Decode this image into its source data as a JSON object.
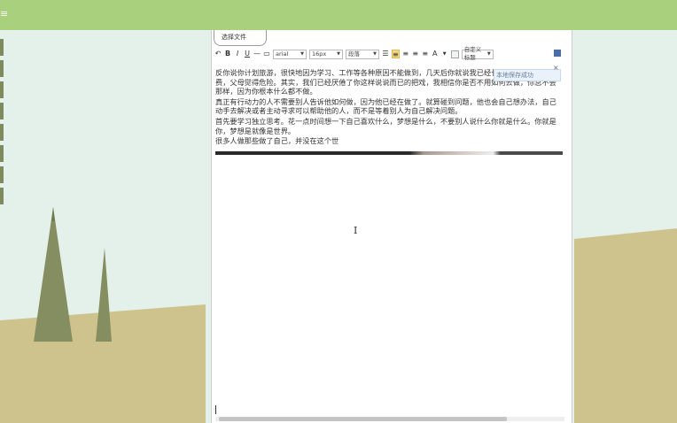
{
  "app": {
    "title": "≡"
  },
  "nav": {
    "items": [
      "",
      "",
      "",
      "",
      "",
      "",
      "",
      ""
    ]
  },
  "editor": {
    "file_button": "选择文件",
    "toolbar": {
      "font_family": "arial",
      "font_size": "16px",
      "format": "段落",
      "text_color": "A",
      "custom_label": "自定义标题"
    },
    "tooltip": "本地保存成功",
    "close_icon": "×",
    "paragraphs": [
      "反你说你计划旅游，很快地因为学习、工作等各种原因不能做到，几天后你就说我已经长途旅行，很是浪费，父母觉得危险。其实，我们已经厌倦了你这样说说而已的把戏，我相信你是否不用如何去做，你总不会那样，因为你根本什么都不做。",
      "真正有行动力的人不需要别人告诉他如何做，因为他已经在做了。就算碰到问题，他也会自己想办法，自己动手去解决或者主动寻求可以帮助他的人，而不是等着别人为自己解决问题。",
      "首先要学习独立思考。花一点时间想一下自己喜欢什么，梦想是什么，不要别人说什么你就是什么。你就是你，梦想是就像是世界。",
      "很多人做那些做了自己，并没在这个世"
    ]
  },
  "colors": {
    "topbar": "#a9d07d",
    "background": "#e4f1ea",
    "hill": "#cfc38d",
    "tree": "#848e60"
  }
}
